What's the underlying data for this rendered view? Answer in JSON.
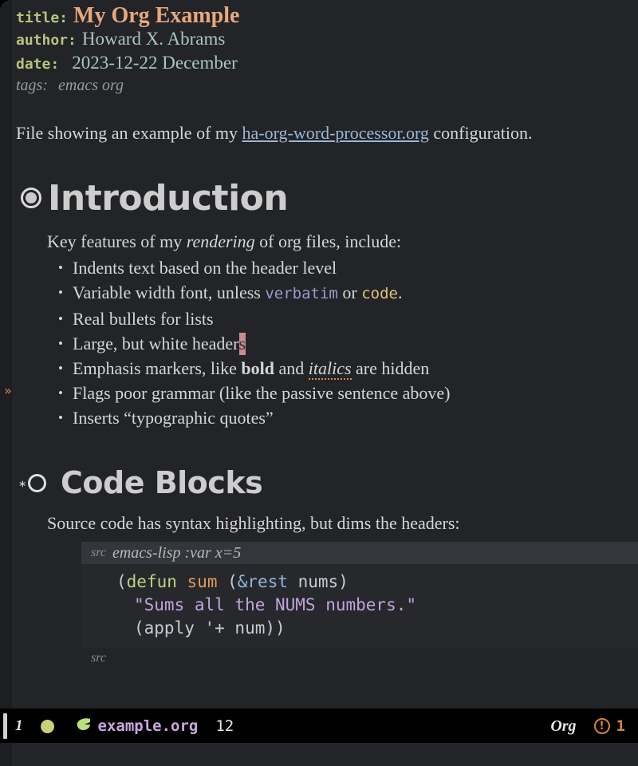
{
  "document": {
    "keywords": [
      {
        "key": "title:",
        "value": "My Org Example"
      },
      {
        "key": "author:",
        "value": "Howard X. Abrams"
      },
      {
        "key": "date:",
        "value": "2023-12-22 December"
      },
      {
        "key": "tags:",
        "value": "emacs org"
      }
    ],
    "intro": {
      "before": "File showing an example of my ",
      "link": "ha-org-word-processor.org",
      "after": " configuration."
    },
    "sections": [
      {
        "heading": "Introduction",
        "bullet_icon": "filled-ring-bullet",
        "lead_before": "Key features of my ",
        "lead_italic": "rendering",
        "lead_after": " of org files, include:",
        "items": [
          {
            "text": "Indents text based on the header level"
          },
          {
            "text_1": "Variable width font, unless ",
            "verbatim": "verbatim",
            "text_2": " or ",
            "code": "code",
            "text_3": "."
          },
          {
            "text": "Real bullets for lists"
          },
          {
            "text_1": "Large, but white header",
            "cursor": "s"
          },
          {
            "text_1": "Emphasis markers, like ",
            "bold": "bold",
            "text_2": " and ",
            "italic": "italics",
            "text_3": " are hidden"
          },
          {
            "text": "Flags poor grammar (like the passive sentence above)"
          },
          {
            "text": "Inserts “typographic quotes”"
          }
        ]
      },
      {
        "heading": "Code Blocks",
        "bullet_icon": "asterisk-hollow-ring-bullet",
        "lead": "Source code has syntax highlighting, but dims the headers:",
        "src_block": {
          "begin_keyword": "src",
          "begin_meta": "emacs-lisp :var x=5",
          "end_keyword": "src",
          "lines": [
            {
              "tokens": [
                {
                  "t": "(",
                  "c": "plain"
                },
                {
                  "t": "defun",
                  "c": "keyword"
                },
                {
                  "t": " ",
                  "c": "plain"
                },
                {
                  "t": "sum",
                  "c": "function"
                },
                {
                  "t": " (",
                  "c": "plain"
                },
                {
                  "t": "&rest",
                  "c": "builtin"
                },
                {
                  "t": " nums)",
                  "c": "plain"
                }
              ]
            },
            {
              "indent": 2,
              "tokens": [
                {
                  "t": "\"Sums all the NUMS numbers.\"",
                  "c": "string"
                }
              ]
            },
            {
              "indent": 2,
              "tokens": [
                {
                  "t": "(apply '+ num))",
                  "c": "plain"
                }
              ]
            }
          ]
        }
      }
    ]
  },
  "modeline": {
    "window_number": "1",
    "status_dot_color": "#cdce7c",
    "emacs_icon": "gnu-emacs-icon",
    "buffer_name": "example.org",
    "line_number": "12",
    "major_mode": "Org",
    "warning_icon": "exclamation-circle-icon",
    "warning_count": "1"
  },
  "fringe": {
    "marker": "»"
  },
  "colors": {
    "background": "#222428",
    "fringe": "#1c1e21",
    "foreground": "#d6d6d6",
    "keyword": "#b9c37c",
    "title": "#e8a87c",
    "meta_value": "#a9c6bf",
    "link": "#9ab8d6",
    "heading": "#cdcdcd",
    "verbatim": "#9a9ad0",
    "code": "#e3c07b",
    "cursor": "#c98d8d",
    "modeline_bg": "#000000",
    "buffer_name": "#cba6e0",
    "warning": "#d0843f"
  }
}
